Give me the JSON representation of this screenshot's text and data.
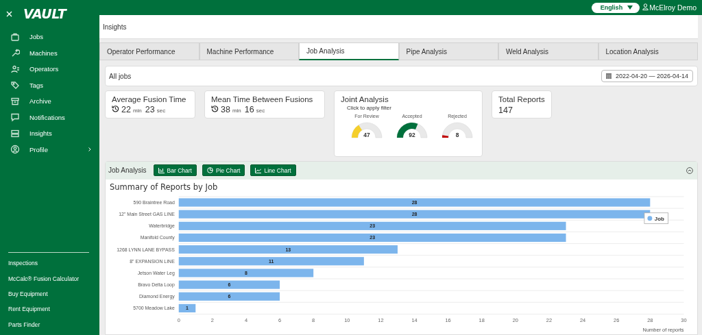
{
  "sidebar": {
    "logo": "VAULT",
    "nav": [
      {
        "label": "Jobs",
        "has_submenu": false
      },
      {
        "label": "Machines",
        "has_submenu": false
      },
      {
        "label": "Operators",
        "has_submenu": false
      },
      {
        "label": "Tags",
        "has_submenu": false
      },
      {
        "label": "Archive",
        "has_submenu": false
      },
      {
        "label": "Notifications",
        "has_submenu": false
      },
      {
        "label": "Insights",
        "has_submenu": false
      },
      {
        "label": "Profile",
        "has_submenu": true
      }
    ],
    "links": [
      "Inspections",
      "McCalc® Fusion Calculator",
      "Buy Equipment",
      "Rent Equipment",
      "Parts Finder"
    ]
  },
  "top_bar": {
    "language": "English",
    "user": "McElroy Demo"
  },
  "page_title": "Insights",
  "tabs": [
    {
      "label": "Operator Performance",
      "selected": false
    },
    {
      "label": "Machine Performance",
      "selected": false
    },
    {
      "label": "Job Analysis",
      "selected": true
    },
    {
      "label": "Pipe Analysis",
      "selected": false
    },
    {
      "label": "Weld Analysis",
      "selected": false
    },
    {
      "label": "Location Analysis",
      "selected": false
    }
  ],
  "filter": {
    "label": "All jobs",
    "date_range": "2022-04-20 — 2026-04-14"
  },
  "stats": [
    {
      "kind": "duration",
      "title": "Average Fusion Time",
      "minutes": "22",
      "min_unit": "min",
      "seconds": "23",
      "sec_unit": "sec"
    },
    {
      "kind": "duration",
      "title": "Mean Time Between Fusions",
      "minutes": "38",
      "min_unit": "min",
      "seconds": "16",
      "sec_unit": "sec"
    },
    {
      "kind": "gauges",
      "title": "Joint Analysis",
      "subtitle": "Click to apply filter",
      "gauges": [
        {
          "label": "For Review",
          "value": "47",
          "color": "#f5cf2c"
        },
        {
          "label": "Accepted",
          "value": "92",
          "color": "#00703c"
        },
        {
          "label": "Rejected",
          "value": "8",
          "color": "#c00000"
        }
      ]
    },
    {
      "kind": "count",
      "title": "Total Reports",
      "value": "147"
    }
  ],
  "analysis": {
    "title": "Job Analysis",
    "buttons": [
      "Bar Chart",
      "Pie Chart",
      "Line Chart"
    ],
    "chart_data": {
      "type": "bar",
      "orientation": "horizontal",
      "title": "Summary of Reports by Job",
      "xlabel": "Number of reports",
      "categories": [
        "590 Braintree Road",
        "12\" Main Street GAS LINE",
        "Waterbridge",
        "Manifold County",
        "1268 LYNN LANE BYPASS",
        "8\" EXPANSION LINE",
        "Jetson Water Leg",
        "Bravo Delta Loop",
        "Diamond Energy",
        "5700 Meadow Lake"
      ],
      "series": [
        {
          "name": "Job",
          "color": "#7cb5ec",
          "values": [
            28,
            28,
            23,
            23,
            13,
            11,
            8,
            6,
            6,
            1
          ]
        }
      ],
      "xlim": [
        0,
        30
      ],
      "xticks": [
        0,
        2,
        4,
        6,
        8,
        10,
        12,
        14,
        16,
        18,
        20,
        22,
        24,
        26,
        28,
        30
      ],
      "data_labels": true
    }
  }
}
